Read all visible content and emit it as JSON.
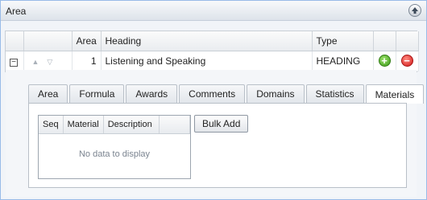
{
  "panel": {
    "title": "Area"
  },
  "grid": {
    "columns": {
      "area": "Area",
      "heading": "Heading",
      "type": "Type"
    },
    "rows": [
      {
        "expander": "−",
        "area": "1",
        "heading": "Listening and Speaking",
        "type": "HEADING"
      }
    ]
  },
  "tabs": [
    "Area",
    "Formula",
    "Awards",
    "Comments",
    "Domains",
    "Statistics",
    "Materials"
  ],
  "active_tab": "Materials",
  "materials": {
    "columns": [
      "Seq",
      "Material",
      "Description"
    ],
    "empty_text": "No data to display",
    "bulk_add_label": "Bulk Add"
  }
}
